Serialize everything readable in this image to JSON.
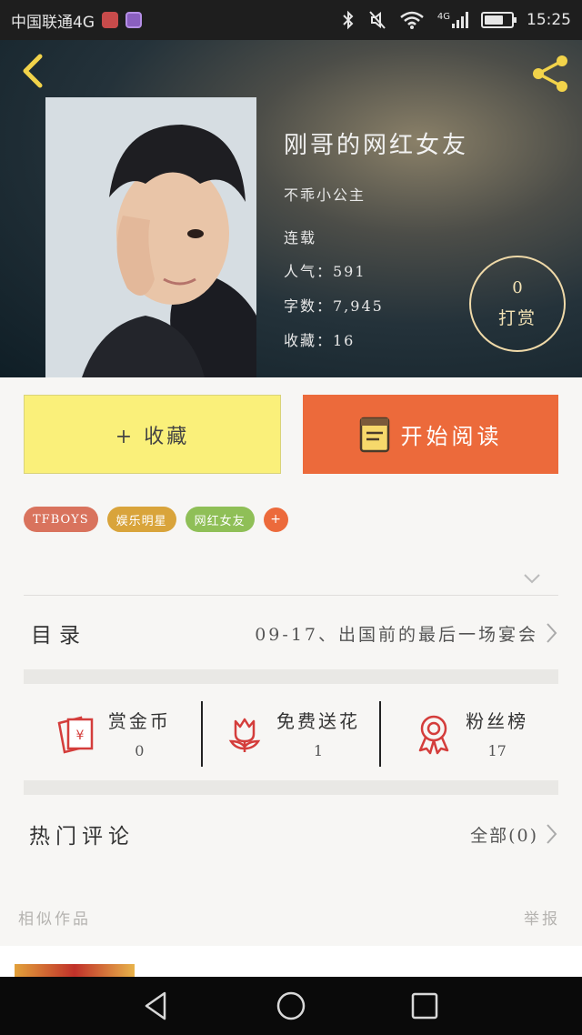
{
  "status_bar": {
    "carrier": "中国联通4G",
    "network": "4G",
    "time": "15:25",
    "battery_level": 0.7
  },
  "header": {
    "back_icon": "back-arrow-icon",
    "share_icon": "share-icon"
  },
  "book": {
    "title": "刚哥的网红女友",
    "author": "不乖小公主",
    "status": "连载",
    "popularity": "人气：591",
    "word_count": "字数：7,945",
    "favorites": "收藏：16"
  },
  "reward": {
    "count": "0",
    "label": "打赏"
  },
  "actions": {
    "collect_label": "+ 收藏",
    "read_label": "开始阅读"
  },
  "tags": [
    {
      "label": "TFBOYS",
      "color": "#d9735d"
    },
    {
      "label": "娱乐明星",
      "color": "#d9a43b"
    },
    {
      "label": "网红女友",
      "color": "#8fbf57"
    }
  ],
  "tag_add_label": "+",
  "toc": {
    "label": "目录",
    "latest_chapter": "09-17、出国前的最后一场宴会"
  },
  "stats": [
    {
      "label": "赏金币",
      "value": "0",
      "icon": "red-envelope-icon"
    },
    {
      "label": "免费送花",
      "value": "1",
      "icon": "flower-icon"
    },
    {
      "label": "粉丝榜",
      "value": "17",
      "icon": "award-ribbon-icon"
    }
  ],
  "comments": {
    "title": "热门评论",
    "all_label": "全部(0)"
  },
  "similar": {
    "title": "相似作品",
    "report_label": "举报"
  },
  "colors": {
    "accent_orange": "#ec6a3b",
    "accent_yellow": "#faf07a",
    "icon_red": "#d43d3b",
    "header_gold": "#f2d34a"
  }
}
